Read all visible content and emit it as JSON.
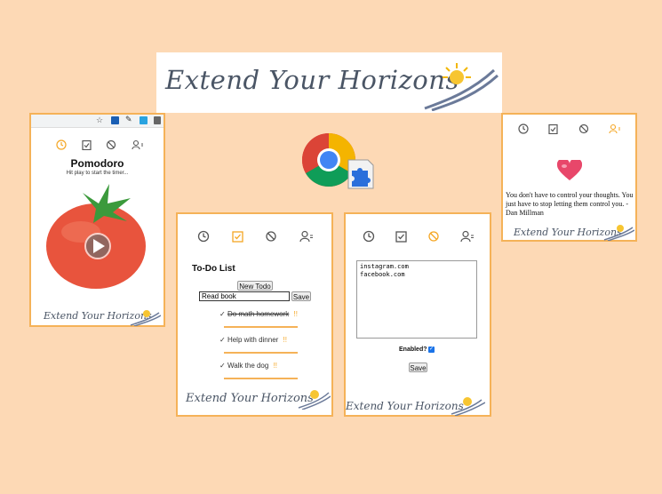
{
  "brand": {
    "name": "Extend Your Horizons"
  },
  "colors": {
    "background": "#fdd9b5",
    "accent": "#f5a623",
    "icon_gray": "#555555",
    "tomato": "#e8543d",
    "leaf": "#3b9a3c"
  },
  "nav_icons": [
    "timer-icon",
    "todo-clipboard-icon",
    "block-icon",
    "account-icon"
  ],
  "pomodoro": {
    "title": "Pomodoro",
    "subtitle": "Hit play to start the timer..."
  },
  "todo": {
    "heading": "To-Do List",
    "new_button": "New Todo",
    "input_value": "Read book",
    "save_button": "Save",
    "items": [
      {
        "text": "Do math homework",
        "done": true,
        "remove": "!!"
      },
      {
        "text": "Help with dinner",
        "done": false,
        "remove": "!!"
      },
      {
        "text": "Walk the dog",
        "done": false,
        "remove": "!!"
      }
    ],
    "check_mark": "✓"
  },
  "blocker": {
    "sites_text": "instagram.com\nfacebook.com",
    "enabled_label": "Enabled?",
    "enabled": true,
    "save_button": "Save"
  },
  "quote": {
    "text": "You don't have to control your thoughts. You just have to stop letting them control you. - Dan Millman"
  }
}
